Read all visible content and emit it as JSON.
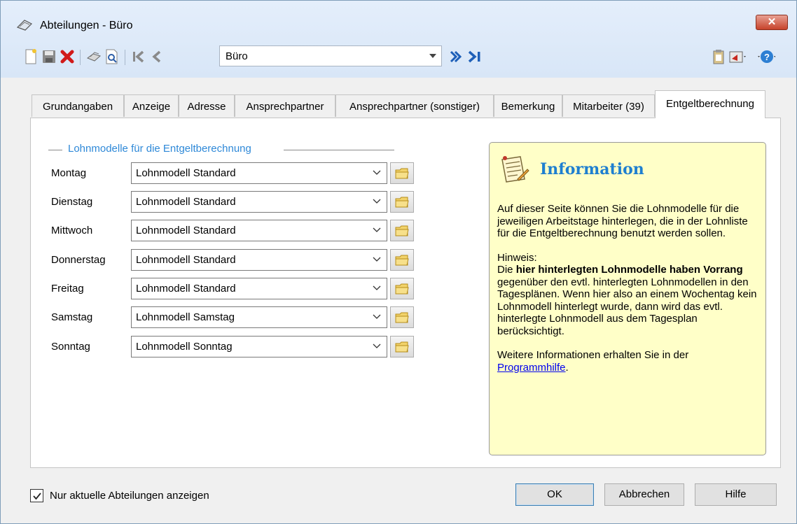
{
  "window": {
    "title": "Abteilungen - Büro",
    "close_glyph": "✕"
  },
  "toolbar": {
    "record_select": {
      "value": "Büro"
    },
    "icons": [
      "new-icon",
      "save-icon",
      "delete-icon",
      "print-icon",
      "preview-icon",
      "first-record-icon",
      "previous-record-icon",
      "next-record-icon",
      "last-record-icon",
      "clipboard-icon",
      "export-icon",
      "help-icon"
    ]
  },
  "tabs": [
    {
      "label": "Grundangaben"
    },
    {
      "label": "Anzeige"
    },
    {
      "label": "Adresse"
    },
    {
      "label": "Ansprechpartner"
    },
    {
      "label": "Ansprechpartner (sonstiger)"
    },
    {
      "label": "Bemerkung"
    },
    {
      "label": "Mitarbeiter (39)"
    },
    {
      "label": "Entgeltberechnung"
    }
  ],
  "active_tab": "Entgeltberechnung",
  "group": {
    "title": "Lohnmodelle für die Entgeltberechnung"
  },
  "rows": [
    {
      "day": "Montag",
      "model": "Lohnmodell Standard"
    },
    {
      "day": "Dienstag",
      "model": "Lohnmodell Standard"
    },
    {
      "day": "Mittwoch",
      "model": "Lohnmodell Standard"
    },
    {
      "day": "Donnerstag",
      "model": "Lohnmodell Standard"
    },
    {
      "day": "Freitag",
      "model": "Lohnmodell Standard"
    },
    {
      "day": "Samstag",
      "model": "Lohnmodell Samstag"
    },
    {
      "day": "Sonntag",
      "model": "Lohnmodell Sonntag"
    }
  ],
  "info": {
    "heading": "Information",
    "para1": "Auf dieser Seite können Sie die Lohnmodelle für die jeweiligen Arbeitstage hinterlegen, die in der Lohnliste für die Entgeltberechnung benutzt werden sollen.",
    "hint_label": "Hinweis:",
    "hint_prefix": "Die ",
    "hint_bold": "hier hinterlegten Lohnmodelle haben Vorrang",
    "hint_rest": " gegenüber den evtl. hinterlegten Lohnmodellen in den Tagesplänen. Wenn hier also an einem Wochentag kein Lohnmodell hinterlegt wurde, dann wird das evtl. hinterlegte Lohnmodell aus dem Tagesplan berücksichtigt.",
    "more_text": "Weitere Informationen erhalten Sie in der",
    "link_text": "Programmhilfe",
    "link_suffix": "."
  },
  "footer": {
    "checkbox_label": "Nur aktuelle Abteilungen anzeigen",
    "checkbox_checked": true,
    "ok_label": "OK",
    "cancel_label": "Abbrechen",
    "help_label": "Hilfe"
  },
  "colors": {
    "accent": "#2f89d8",
    "info_bg": "#ffffc8",
    "link": "#0000ee"
  }
}
